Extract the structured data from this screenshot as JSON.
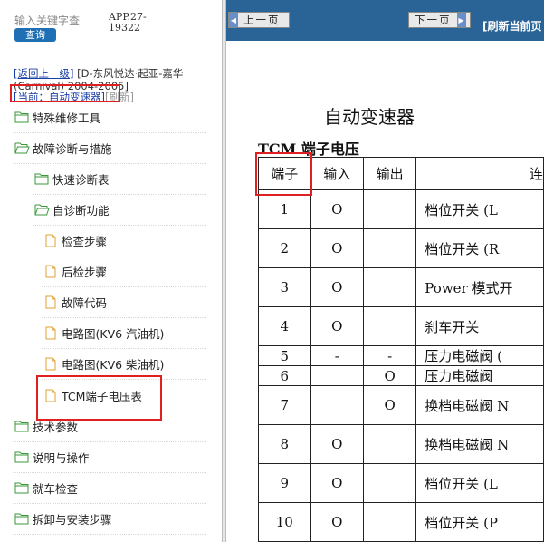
{
  "search": {
    "keyword_label": "输入关键字查",
    "query_button": "查询",
    "app_code": "APP.27-19322"
  },
  "nav": {
    "back_link": "[返回上一级]",
    "path_text": "[D-东风悦达·起亚-嘉华(Carnival) 2004-2005]",
    "current_link": "[当前：自动变速器]",
    "refresh_link": "[刷新]"
  },
  "tree": [
    {
      "label": "特殊维修工具"
    },
    {
      "label": "故障诊断与措施"
    },
    {
      "label": "快速诊断表"
    },
    {
      "label": "自诊断功能"
    },
    {
      "label": "检查步骤"
    },
    {
      "label": "后检步骤"
    },
    {
      "label": "故障代码"
    },
    {
      "label": "电路图(KV6 汽油机)"
    },
    {
      "label": "电路图(KV6 柴油机)"
    },
    {
      "label": "TCM端子电压表"
    },
    {
      "label": "技术参数"
    },
    {
      "label": "说明与操作"
    },
    {
      "label": "就车检查"
    },
    {
      "label": "拆卸与安装步骤"
    }
  ],
  "toolbar": {
    "prev_label": "上一页",
    "next_label": "下一页",
    "refresh_label": "[刷新当前页"
  },
  "document": {
    "title": "自动变速器",
    "subtitle": "TCM 端子电压",
    "headers": [
      "端子",
      "输入",
      "输出",
      "连"
    ],
    "rows": [
      [
        "1",
        "O",
        "",
        "档位开关 (L"
      ],
      [
        "2",
        "O",
        "",
        "档位开关 (R"
      ],
      [
        "3",
        "O",
        "",
        "Power 模式开"
      ],
      [
        "4",
        "O",
        "",
        "刹车开关"
      ],
      [
        "5",
        "-",
        "-",
        "压力电磁阀 ("
      ],
      [
        "6",
        "",
        "O",
        "压力电磁阀"
      ],
      [
        "7",
        "",
        "O",
        "换档电磁阀 N"
      ],
      [
        "8",
        "O",
        "",
        "换档电磁阀 N"
      ],
      [
        "9",
        "O",
        "",
        "档位开关 (L"
      ],
      [
        "10",
        "O",
        "",
        "档位开关 (P"
      ]
    ]
  },
  "colors": {
    "toolbar": "#2a6496",
    "highlight": "#e02020",
    "link": "#1a3fa8",
    "query_button": "#1f6fb5"
  },
  "icons": {
    "folder_open": "folder-open-icon",
    "folder_closed": "folder-icon",
    "document": "document-icon"
  }
}
